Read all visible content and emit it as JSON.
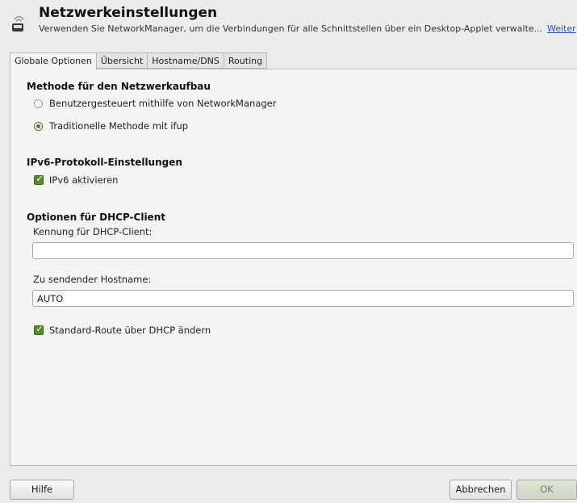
{
  "header": {
    "title": "Netzwerkeinstellungen",
    "description": "Verwenden Sie NetworkManager, um die Verbindungen für alle Schnittstellen über ein Desktop-Applet verwalte...",
    "more_link": "Weiter"
  },
  "tabs": [
    {
      "label": "Globale Optionen",
      "active": true
    },
    {
      "label": "Übersicht",
      "active": false
    },
    {
      "label": "Hostname/DNS",
      "active": false
    },
    {
      "label": "Routing",
      "active": false
    }
  ],
  "setup_method": {
    "title": "Methode für den Netzwerkaufbau",
    "options": [
      {
        "label": "Benutzergesteuert mithilfe von NetworkManager",
        "checked": false
      },
      {
        "label": "Traditionelle Methode mit ifup",
        "checked": true
      }
    ]
  },
  "ipv6": {
    "title": "IPv6-Protokoll-Einstellungen",
    "enable_label": "IPv6 aktivieren",
    "enabled": true
  },
  "dhcp": {
    "title": "Optionen für DHCP-Client",
    "client_id_label": "Kennung für DHCP-Client:",
    "client_id_value": "",
    "hostname_label": "Zu sendender Hostname:",
    "hostname_value": "AUTO",
    "default_route_label": "Standard-Route über DHCP ändern",
    "default_route_checked": true
  },
  "footer": {
    "help": "Hilfe",
    "cancel": "Abbrechen",
    "ok": "OK"
  },
  "colors": {
    "checkbox": "#5b8a2c",
    "link": "#2a55b8",
    "background": "#ececec"
  },
  "icons": {
    "header": "network-settings-icon"
  }
}
